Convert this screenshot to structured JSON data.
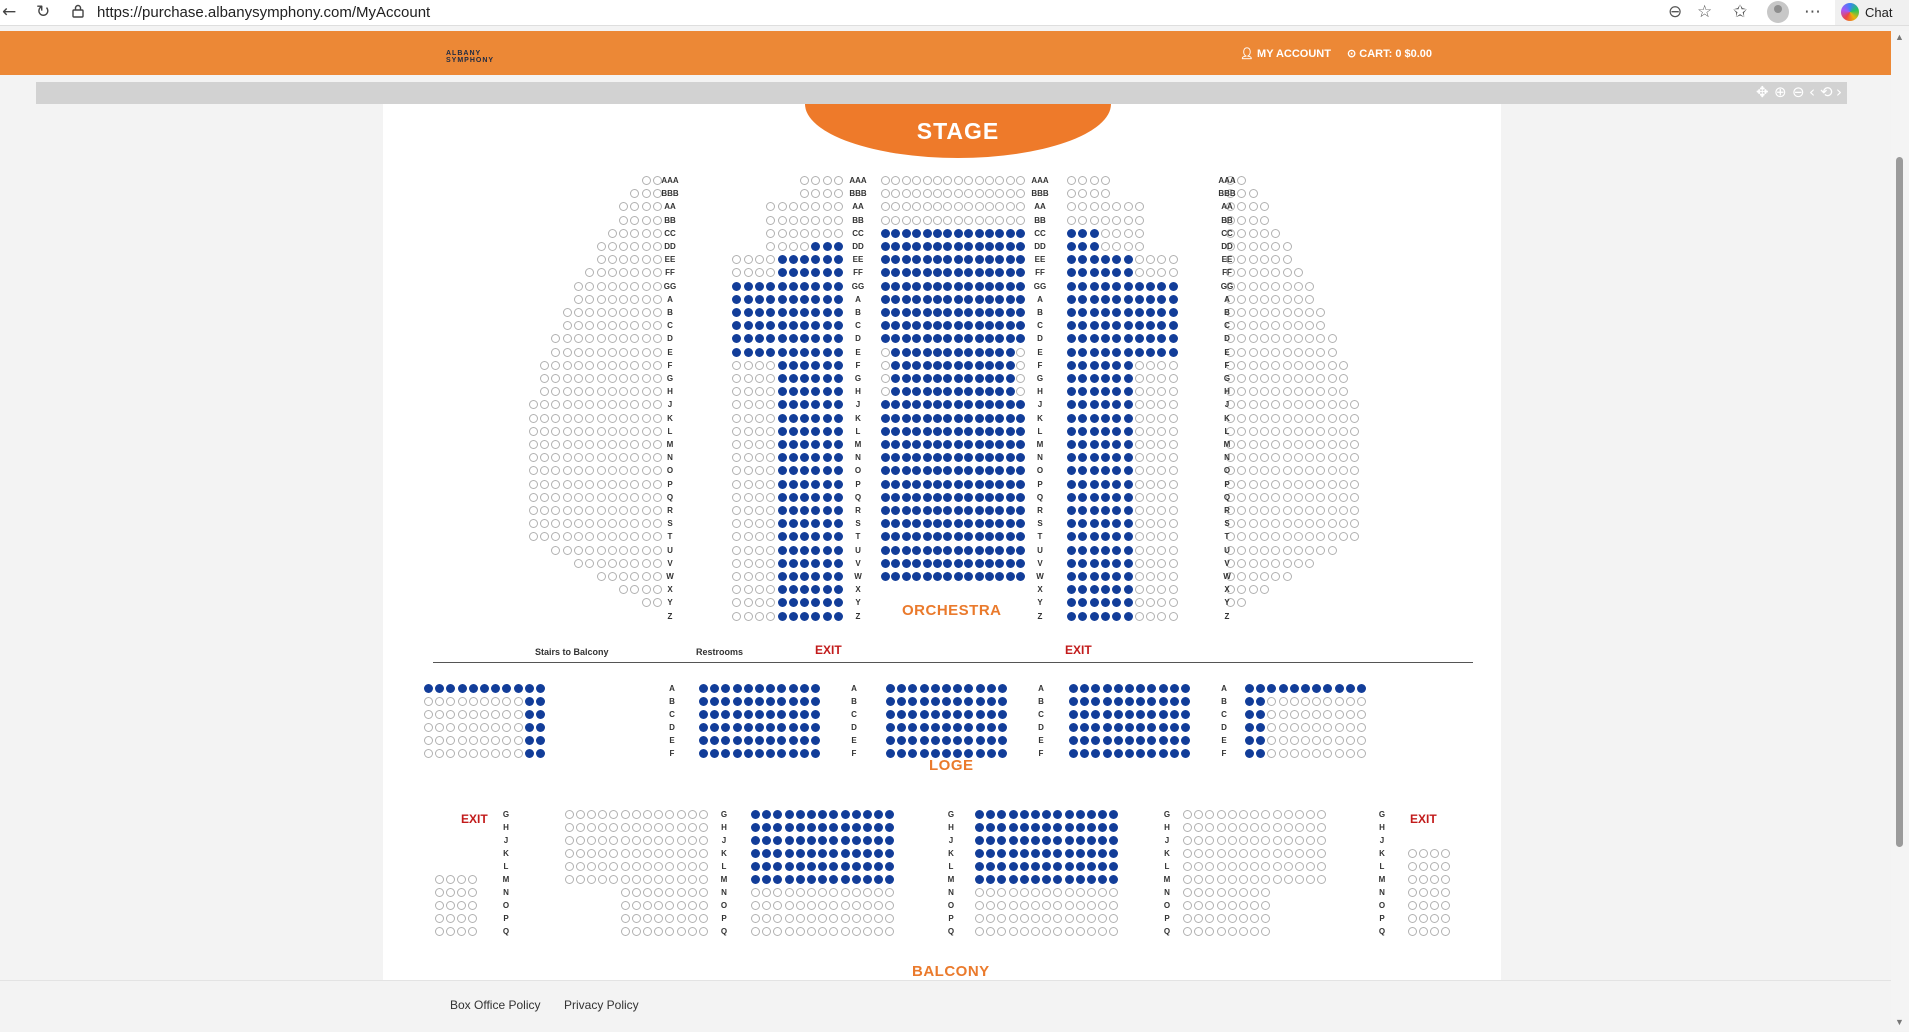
{
  "browser": {
    "url": "https://purchase.albanysymphony.com/MyAccount",
    "chat_label": "Chat"
  },
  "header": {
    "brand_line1": "ALBANY",
    "brand_line2": "SYMPHONY",
    "my_account": "MY ACCOUNT",
    "cart": "CART: 0  $0.00",
    "color": "#ec8836"
  },
  "map": {
    "stage": "STAGE",
    "orchestra": "ORCHESTRA",
    "loge": "LOGE",
    "balcony": "BALCONY",
    "exit": "EXIT",
    "stairs": "Stairs to Balcony",
    "restrooms": "Restrooms",
    "available_color": "#123d99",
    "orchestra_rows": [
      "AAA",
      "BBB",
      "AA",
      "BB",
      "CC",
      "DD",
      "EE",
      "FF",
      "GG",
      "A",
      "B",
      "C",
      "D",
      "E",
      "F",
      "G",
      "H",
      "J",
      "K",
      "L",
      "M",
      "N",
      "O",
      "P",
      "Q",
      "R",
      "S",
      "T",
      "U",
      "V",
      "W",
      "X",
      "Y",
      "Z"
    ],
    "loge_rows": [
      "A",
      "B",
      "C",
      "D",
      "E",
      "F"
    ],
    "balcony_rows": [
      "G",
      "H",
      "J",
      "K",
      "L",
      "M",
      "N",
      "O",
      "P",
      "Q"
    ]
  },
  "footer": {
    "box_office": "Box Office Policy",
    "privacy": "Privacy Policy"
  }
}
